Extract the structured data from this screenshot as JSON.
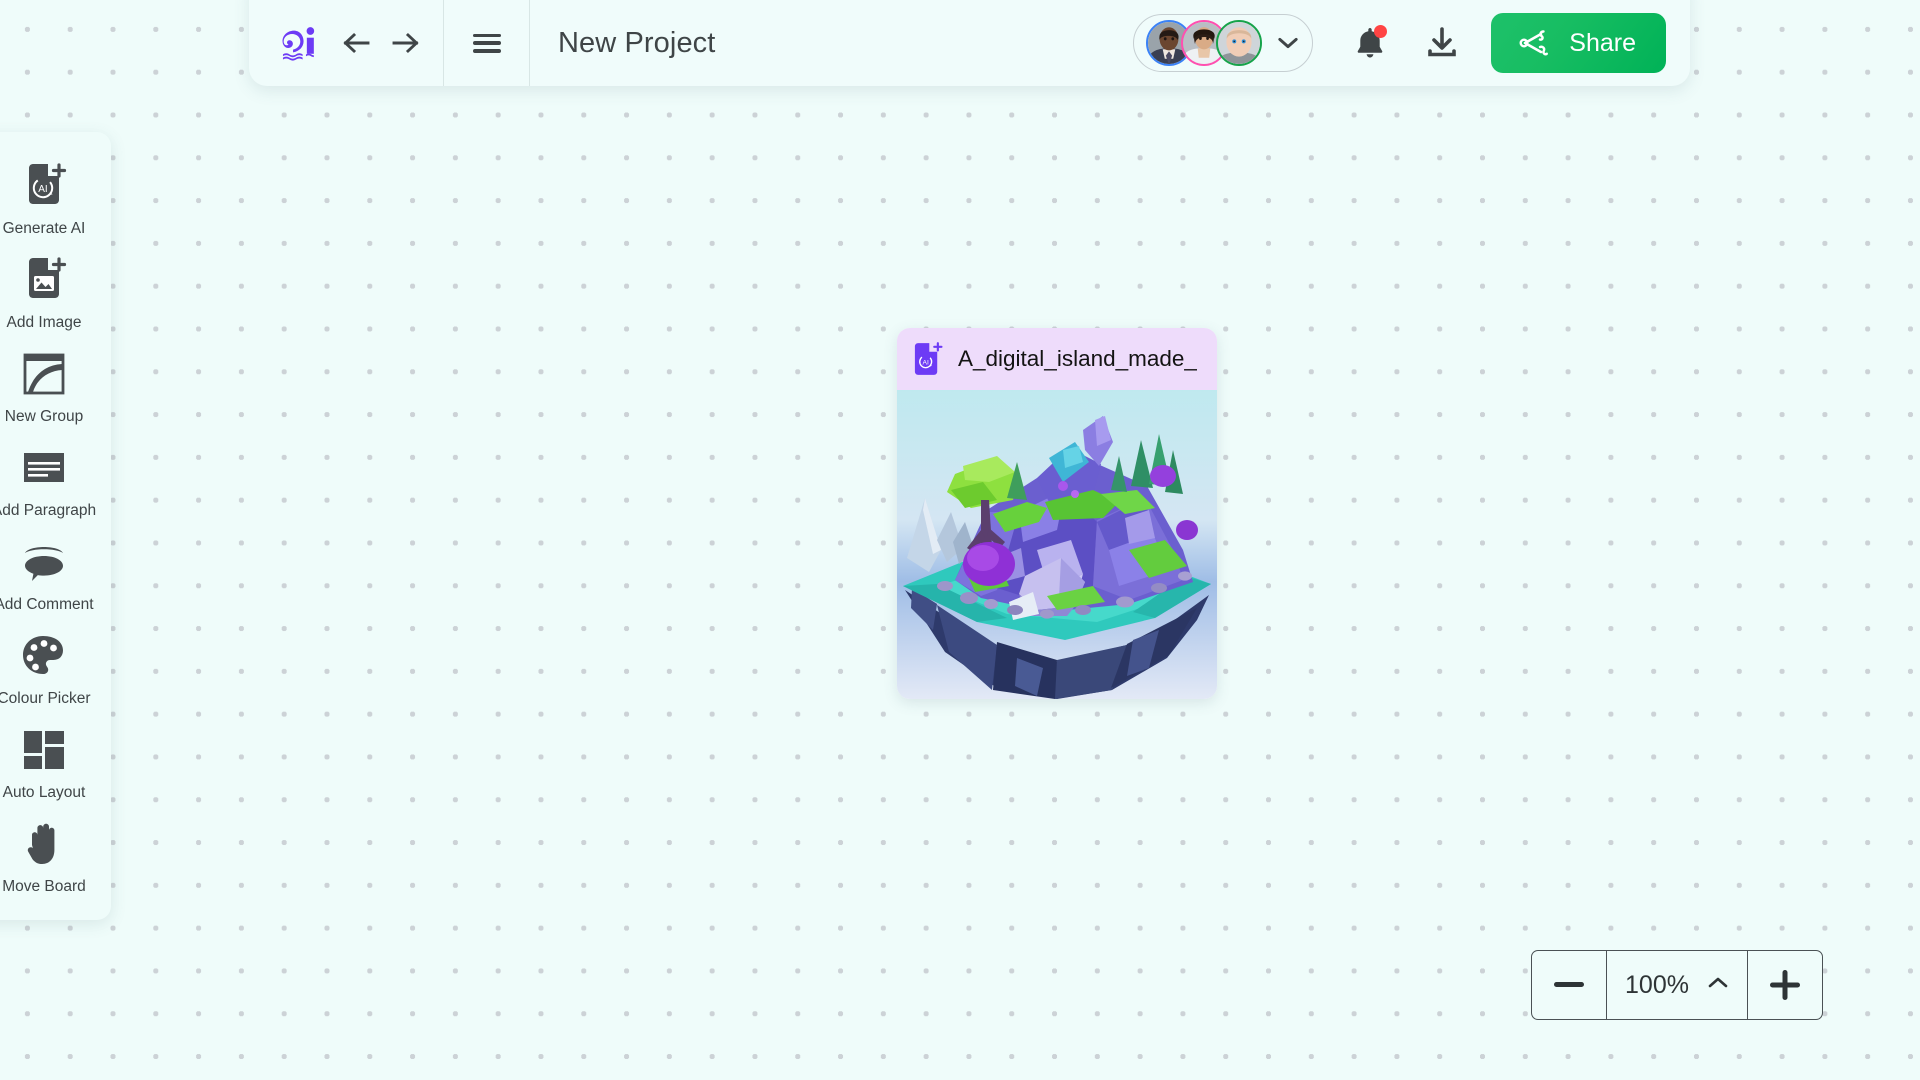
{
  "app": {
    "logo_name": "ai-logo",
    "canvas_background": "#effcfa",
    "dot_color": "#ccd2d6"
  },
  "toolbar": {
    "undo_label": "←",
    "redo_label": "→",
    "menu_label": "menu",
    "project_title": "New Project",
    "collaborators": [
      {
        "name": "collaborator-1",
        "ring_color": "#3b82f6"
      },
      {
        "name": "collaborator-2",
        "ring_color": "#ff4fb0"
      },
      {
        "name": "collaborator-3",
        "ring_color": "#16a34a"
      }
    ],
    "collaborators_chevron": "chevron-down-icon",
    "notification_icon": "bell-icon",
    "notification_has_badge": true,
    "download_icon": "download-icon",
    "share_label": "Share",
    "share_color": "#17bd62"
  },
  "sidebar": {
    "items": [
      {
        "label": "Generate AI",
        "icon": "generate-ai-icon"
      },
      {
        "label": "Add Image",
        "icon": "add-image-icon"
      },
      {
        "label": "New Group",
        "icon": "new-group-icon"
      },
      {
        "label": "Add Paragraph",
        "icon": "add-paragraph-icon"
      },
      {
        "label": "Add Comment",
        "icon": "add-comment-icon"
      },
      {
        "label": "Colour Picker",
        "icon": "colour-picker-icon"
      },
      {
        "label": "Auto Layout",
        "icon": "auto-layout-icon"
      },
      {
        "label": "Move Board",
        "icon": "move-board-icon"
      }
    ]
  },
  "canvas": {
    "card": {
      "title": "A_digital_island_made_",
      "icon": "generate-ai-icon",
      "header_color": "#eedcfb",
      "image_alt": "low-poly floating island with purple rocks, green trees and turquoise water"
    }
  },
  "zoom_control": {
    "decrease_label": "−",
    "level": "100%",
    "chevron": "chevron-up-icon",
    "increase_label": "+"
  }
}
